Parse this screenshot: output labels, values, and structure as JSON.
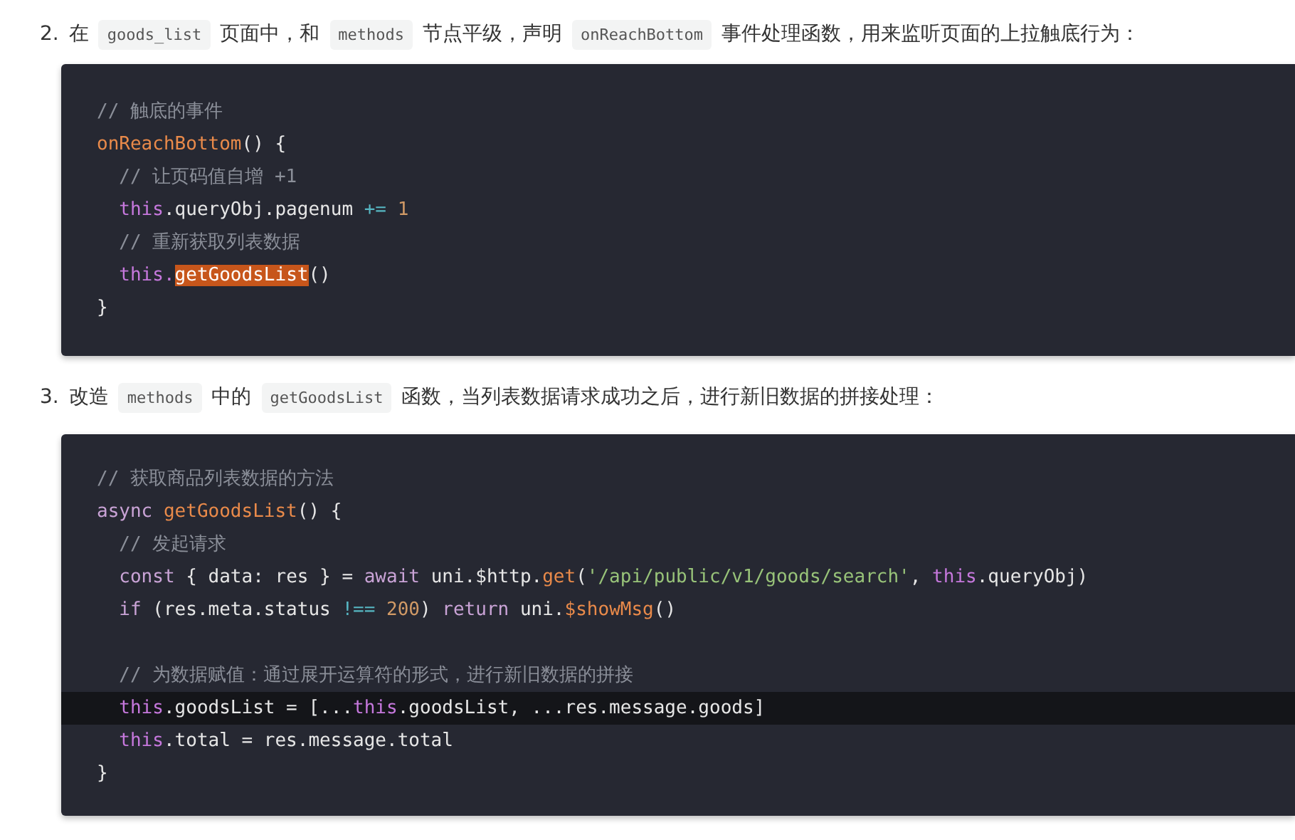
{
  "steps": [
    {
      "number": "2.",
      "parts": [
        {
          "kind": "text",
          "text": "在"
        },
        {
          "kind": "code",
          "text": "goods_list"
        },
        {
          "kind": "text",
          "text": "页面中，和"
        },
        {
          "kind": "code",
          "text": "methods"
        },
        {
          "kind": "text",
          "text": "节点平级，声明"
        },
        {
          "kind": "code",
          "text": "onReachBottom"
        },
        {
          "kind": "text",
          "text": "事件处理函数，用来监听页面的上拉触底行为："
        }
      ],
      "code": [
        {
          "highlighted": false,
          "tokens": [
            {
              "kind": "comment",
              "text": "// 触底的事件"
            }
          ]
        },
        {
          "highlighted": false,
          "tokens": [
            {
              "kind": "func",
              "text": "onReachBottom"
            },
            {
              "kind": "plain",
              "text": "() {"
            }
          ]
        },
        {
          "highlighted": false,
          "tokens": [
            {
              "kind": "comment",
              "text": "  // 让页码值自增 +1"
            }
          ]
        },
        {
          "highlighted": false,
          "tokens": [
            {
              "kind": "this",
              "text": "  this"
            },
            {
              "kind": "plain",
              "text": ".queryObj.pagenum "
            },
            {
              "kind": "operator",
              "text": "+="
            },
            {
              "kind": "number",
              "text": " 1"
            }
          ]
        },
        {
          "highlighted": false,
          "tokens": [
            {
              "kind": "comment",
              "text": "  // 重新获取列表数据"
            }
          ]
        },
        {
          "highlighted": false,
          "tokens": [
            {
              "kind": "this",
              "text": "  this."
            },
            {
              "kind": "plain",
              "text": "getGoodsList",
              "selected": true
            },
            {
              "kind": "plain",
              "text": "()"
            }
          ]
        },
        {
          "highlighted": false,
          "tokens": [
            {
              "kind": "plain",
              "text": "}"
            }
          ]
        }
      ]
    },
    {
      "number": "3.",
      "parts": [
        {
          "kind": "text",
          "text": "改造"
        },
        {
          "kind": "code",
          "text": "methods"
        },
        {
          "kind": "text",
          "text": "中的"
        },
        {
          "kind": "code",
          "text": "getGoodsList"
        },
        {
          "kind": "text",
          "text": "函数，当列表数据请求成功之后，进行新旧数据的拼接处理："
        }
      ],
      "code": [
        {
          "highlighted": false,
          "tokens": [
            {
              "kind": "comment",
              "text": "// 获取商品列表数据的方法"
            }
          ]
        },
        {
          "highlighted": false,
          "tokens": [
            {
              "kind": "keyword",
              "text": "async "
            },
            {
              "kind": "func",
              "text": "getGoodsList"
            },
            {
              "kind": "plain",
              "text": "() {"
            }
          ]
        },
        {
          "highlighted": false,
          "tokens": [
            {
              "kind": "comment",
              "text": "  // 发起请求"
            }
          ]
        },
        {
          "highlighted": false,
          "tokens": [
            {
              "kind": "keyword",
              "text": "  const"
            },
            {
              "kind": "plain",
              "text": " { data: res } = "
            },
            {
              "kind": "keyword",
              "text": "await"
            },
            {
              "kind": "plain",
              "text": " uni.$http."
            },
            {
              "kind": "func",
              "text": "get"
            },
            {
              "kind": "plain",
              "text": "("
            },
            {
              "kind": "string",
              "text": "'/api/public/v1/goods/search'"
            },
            {
              "kind": "plain",
              "text": ", "
            },
            {
              "kind": "this",
              "text": "this"
            },
            {
              "kind": "plain",
              "text": ".queryObj)"
            }
          ]
        },
        {
          "highlighted": false,
          "tokens": [
            {
              "kind": "keyword",
              "text": "  if"
            },
            {
              "kind": "plain",
              "text": " (res.meta.status "
            },
            {
              "kind": "operator",
              "text": "!=="
            },
            {
              "kind": "number",
              "text": " 200"
            },
            {
              "kind": "plain",
              "text": ") "
            },
            {
              "kind": "keyword",
              "text": "return"
            },
            {
              "kind": "plain",
              "text": " uni."
            },
            {
              "kind": "func",
              "text": "$showMsg"
            },
            {
              "kind": "plain",
              "text": "()"
            }
          ]
        },
        {
          "highlighted": false
        },
        {
          "highlighted": false,
          "tokens": [
            {
              "kind": "comment",
              "text": "  // 为数据赋值：通过展开运算符的形式，进行新旧数据的拼接"
            }
          ]
        },
        {
          "highlighted": true,
          "tokens": [
            {
              "kind": "this",
              "text": "  this"
            },
            {
              "kind": "plain",
              "text": ".goodsList = [..."
            },
            {
              "kind": "this",
              "text": "this"
            },
            {
              "kind": "plain",
              "text": ".goodsList, ...res.message.goods]"
            }
          ]
        },
        {
          "highlighted": false,
          "tokens": [
            {
              "kind": "this",
              "text": "  this"
            },
            {
              "kind": "plain",
              "text": ".total = res.message.total"
            }
          ]
        },
        {
          "highlighted": false,
          "tokens": [
            {
              "kind": "plain",
              "text": "}"
            }
          ]
        }
      ]
    }
  ]
}
